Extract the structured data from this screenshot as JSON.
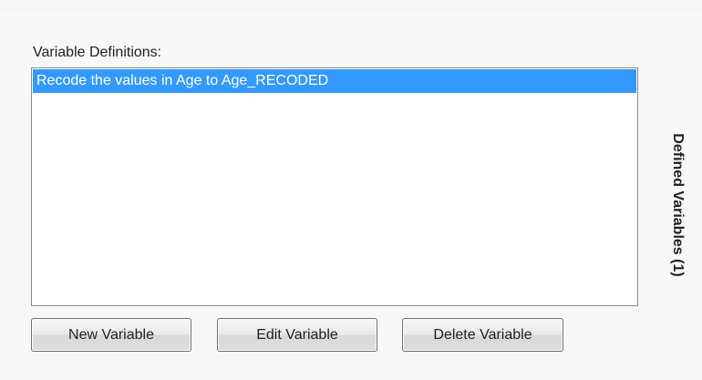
{
  "variable_definitions": {
    "label": "Variable Definitions:",
    "items": [
      {
        "text": "Recode the values in Age to Age_RECODED",
        "selected": true
      }
    ]
  },
  "buttons": {
    "new": "New Variable",
    "edit": "Edit Variable",
    "delete": "Delete Variable"
  },
  "side_tab": {
    "label": "Defined Variables (1)"
  },
  "colors": {
    "selection": "#3399ff",
    "panel_background": "#f8f8f8",
    "list_background": "#ffffff"
  }
}
